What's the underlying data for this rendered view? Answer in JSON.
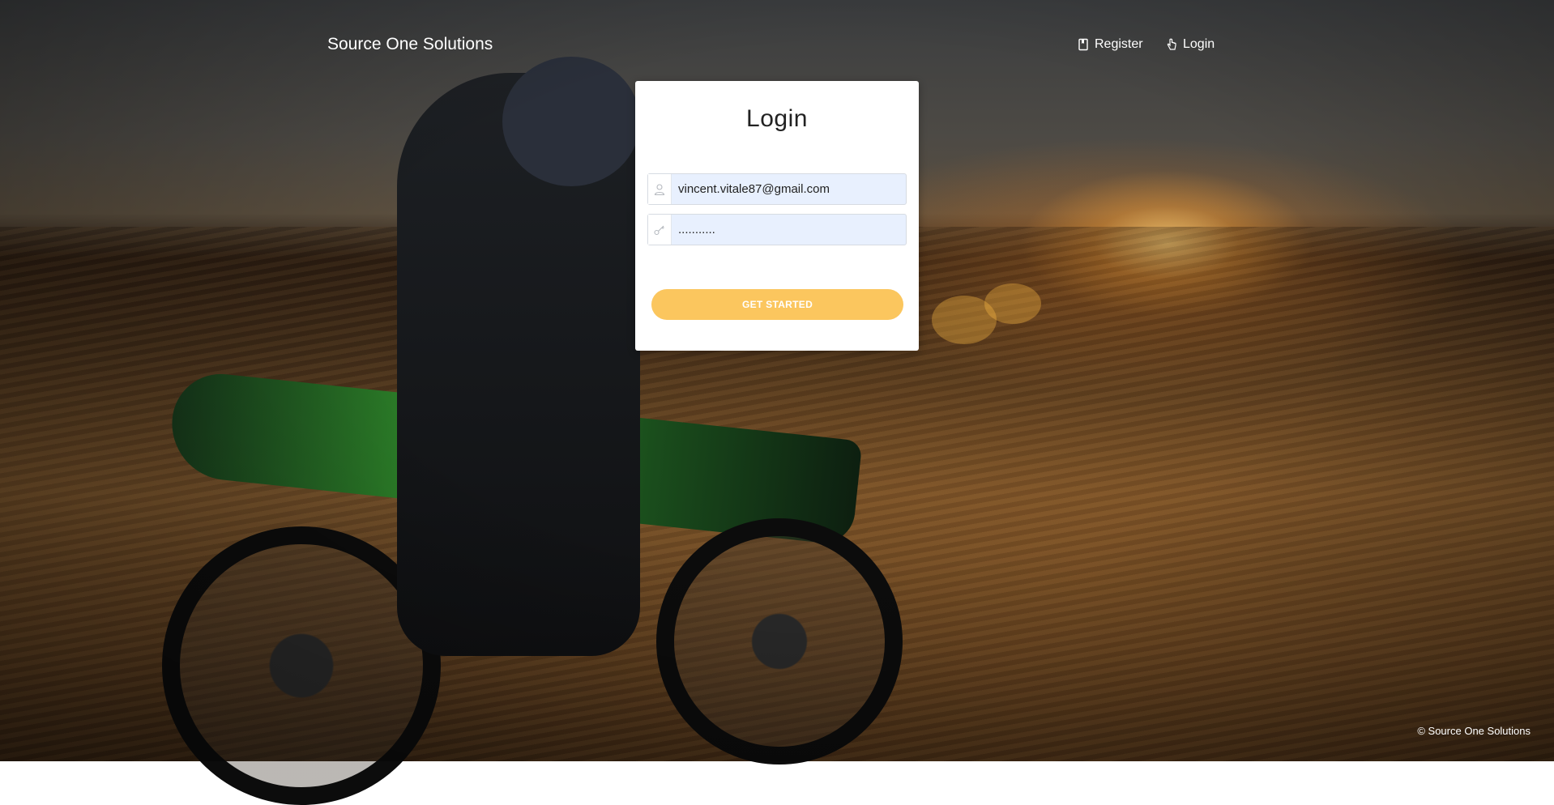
{
  "header": {
    "brand": "Source One Solutions",
    "nav": [
      {
        "label": "Register",
        "icon": "book-icon"
      },
      {
        "label": "Login",
        "icon": "hand-pointer-icon"
      }
    ]
  },
  "login_card": {
    "title": "Login",
    "email": {
      "value": "vincent.vitale87@gmail.com",
      "icon": "user-icon"
    },
    "password": {
      "value": "...........",
      "icon": "key-icon"
    },
    "submit_label": "GET STARTED"
  },
  "footer": {
    "copyright": "© Source One Solutions"
  },
  "colors": {
    "button": "#fbc65e",
    "input_bg": "#e8f0fe",
    "card_bg": "#ffffff",
    "text_on_bg": "#ffffff"
  }
}
